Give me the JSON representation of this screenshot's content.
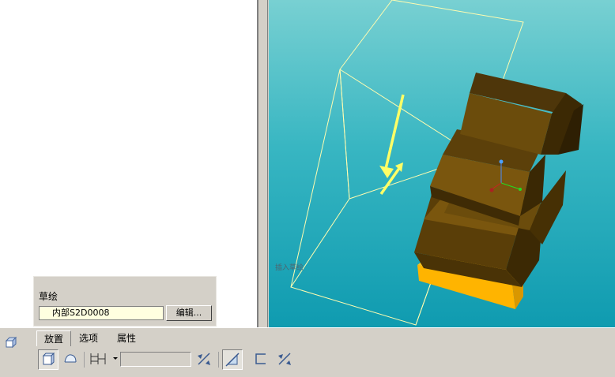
{
  "viewport": {
    "label": "插入草绘"
  },
  "sketch_panel": {
    "title": "草绘",
    "section_value": "内部S2D0008",
    "edit_label": "编辑..."
  },
  "dashboard": {
    "tabs": [
      {
        "label": "放置"
      },
      {
        "label": "选项"
      },
      {
        "label": "属性"
      }
    ],
    "depth_value": ""
  },
  "colors": {
    "tree_bg": "#ffffff",
    "viewport_top": "#78d0d2",
    "viewport_bottom": "#0f9bb0",
    "model_brown": "#6b4c0c",
    "model_yellow": "#ffb400",
    "ui_gray": "#d4d0c8"
  }
}
